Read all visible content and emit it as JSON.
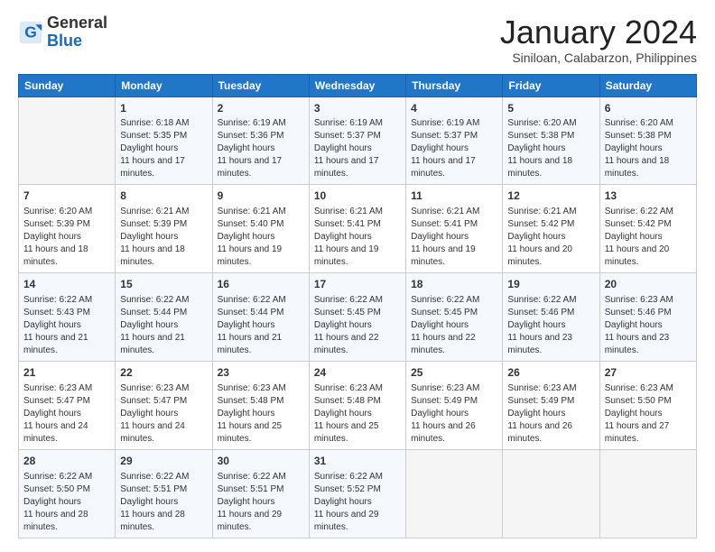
{
  "logo": {
    "general": "General",
    "blue": "Blue"
  },
  "header": {
    "month": "January 2024",
    "location": "Siniloan, Calabarzon, Philippines"
  },
  "weekdays": [
    "Sunday",
    "Monday",
    "Tuesday",
    "Wednesday",
    "Thursday",
    "Friday",
    "Saturday"
  ],
  "weeks": [
    [
      {
        "day": "",
        "empty": true
      },
      {
        "day": "1",
        "sunrise": "6:18 AM",
        "sunset": "5:35 PM",
        "daylight": "11 hours and 17 minutes."
      },
      {
        "day": "2",
        "sunrise": "6:19 AM",
        "sunset": "5:36 PM",
        "daylight": "11 hours and 17 minutes."
      },
      {
        "day": "3",
        "sunrise": "6:19 AM",
        "sunset": "5:37 PM",
        "daylight": "11 hours and 17 minutes."
      },
      {
        "day": "4",
        "sunrise": "6:19 AM",
        "sunset": "5:37 PM",
        "daylight": "11 hours and 17 minutes."
      },
      {
        "day": "5",
        "sunrise": "6:20 AM",
        "sunset": "5:38 PM",
        "daylight": "11 hours and 18 minutes."
      },
      {
        "day": "6",
        "sunrise": "6:20 AM",
        "sunset": "5:38 PM",
        "daylight": "11 hours and 18 minutes."
      }
    ],
    [
      {
        "day": "7",
        "sunrise": "6:20 AM",
        "sunset": "5:39 PM",
        "daylight": "11 hours and 18 minutes."
      },
      {
        "day": "8",
        "sunrise": "6:21 AM",
        "sunset": "5:39 PM",
        "daylight": "11 hours and 18 minutes."
      },
      {
        "day": "9",
        "sunrise": "6:21 AM",
        "sunset": "5:40 PM",
        "daylight": "11 hours and 19 minutes."
      },
      {
        "day": "10",
        "sunrise": "6:21 AM",
        "sunset": "5:41 PM",
        "daylight": "11 hours and 19 minutes."
      },
      {
        "day": "11",
        "sunrise": "6:21 AM",
        "sunset": "5:41 PM",
        "daylight": "11 hours and 19 minutes."
      },
      {
        "day": "12",
        "sunrise": "6:21 AM",
        "sunset": "5:42 PM",
        "daylight": "11 hours and 20 minutes."
      },
      {
        "day": "13",
        "sunrise": "6:22 AM",
        "sunset": "5:42 PM",
        "daylight": "11 hours and 20 minutes."
      }
    ],
    [
      {
        "day": "14",
        "sunrise": "6:22 AM",
        "sunset": "5:43 PM",
        "daylight": "11 hours and 21 minutes."
      },
      {
        "day": "15",
        "sunrise": "6:22 AM",
        "sunset": "5:44 PM",
        "daylight": "11 hours and 21 minutes."
      },
      {
        "day": "16",
        "sunrise": "6:22 AM",
        "sunset": "5:44 PM",
        "daylight": "11 hours and 21 minutes."
      },
      {
        "day": "17",
        "sunrise": "6:22 AM",
        "sunset": "5:45 PM",
        "daylight": "11 hours and 22 minutes."
      },
      {
        "day": "18",
        "sunrise": "6:22 AM",
        "sunset": "5:45 PM",
        "daylight": "11 hours and 22 minutes."
      },
      {
        "day": "19",
        "sunrise": "6:22 AM",
        "sunset": "5:46 PM",
        "daylight": "11 hours and 23 minutes."
      },
      {
        "day": "20",
        "sunrise": "6:23 AM",
        "sunset": "5:46 PM",
        "daylight": "11 hours and 23 minutes."
      }
    ],
    [
      {
        "day": "21",
        "sunrise": "6:23 AM",
        "sunset": "5:47 PM",
        "daylight": "11 hours and 24 minutes."
      },
      {
        "day": "22",
        "sunrise": "6:23 AM",
        "sunset": "5:47 PM",
        "daylight": "11 hours and 24 minutes."
      },
      {
        "day": "23",
        "sunrise": "6:23 AM",
        "sunset": "5:48 PM",
        "daylight": "11 hours and 25 minutes."
      },
      {
        "day": "24",
        "sunrise": "6:23 AM",
        "sunset": "5:48 PM",
        "daylight": "11 hours and 25 minutes."
      },
      {
        "day": "25",
        "sunrise": "6:23 AM",
        "sunset": "5:49 PM",
        "daylight": "11 hours and 26 minutes."
      },
      {
        "day": "26",
        "sunrise": "6:23 AM",
        "sunset": "5:49 PM",
        "daylight": "11 hours and 26 minutes."
      },
      {
        "day": "27",
        "sunrise": "6:23 AM",
        "sunset": "5:50 PM",
        "daylight": "11 hours and 27 minutes."
      }
    ],
    [
      {
        "day": "28",
        "sunrise": "6:22 AM",
        "sunset": "5:50 PM",
        "daylight": "11 hours and 28 minutes."
      },
      {
        "day": "29",
        "sunrise": "6:22 AM",
        "sunset": "5:51 PM",
        "daylight": "11 hours and 28 minutes."
      },
      {
        "day": "30",
        "sunrise": "6:22 AM",
        "sunset": "5:51 PM",
        "daylight": "11 hours and 29 minutes."
      },
      {
        "day": "31",
        "sunrise": "6:22 AM",
        "sunset": "5:52 PM",
        "daylight": "11 hours and 29 minutes."
      },
      {
        "day": "",
        "empty": true
      },
      {
        "day": "",
        "empty": true
      },
      {
        "day": "",
        "empty": true
      }
    ]
  ],
  "labels": {
    "sunrise": "Sunrise:",
    "sunset": "Sunset:",
    "daylight": "Daylight:"
  }
}
